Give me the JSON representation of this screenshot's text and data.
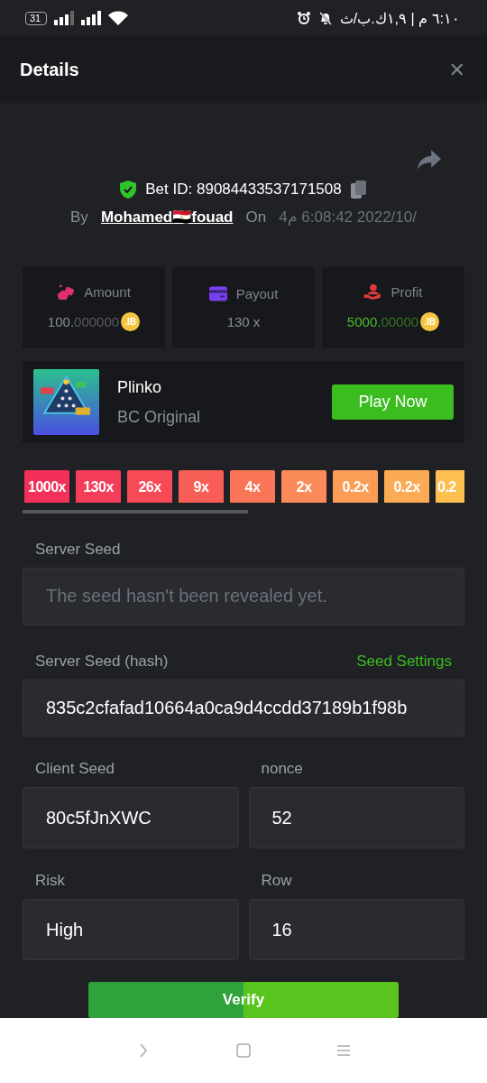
{
  "status_bar": {
    "battery": "31",
    "time": "٦:١٠ م | ١,٩ك.ب/ث"
  },
  "header": {
    "title": "Details",
    "close": "✕"
  },
  "bet": {
    "id_label": "Bet ID: 89084433537171508",
    "by": "By",
    "user": "Mohamed🇪🇬fouad",
    "on": "On",
    "date": "4م 6:08:42 2022/10/"
  },
  "stats": [
    {
      "kind": "amount",
      "label": "Amount",
      "value_main": "100.",
      "value_dim": "000000",
      "coin": ".IB"
    },
    {
      "kind": "payout",
      "label": "Payout",
      "value_main": "130 x"
    },
    {
      "kind": "profit",
      "label": "Profit",
      "value_main": "5000.",
      "value_dim": "00000",
      "coin": ".IB"
    }
  ],
  "game": {
    "kind": "picture",
    "name": "Plinko",
    "provider": "BC Original",
    "button": "Play Now"
  },
  "multipliers": [
    {
      "label": "1000x",
      "color": "#f2305a"
    },
    {
      "label": "130x",
      "color": "#f43d58"
    },
    {
      "label": "26x",
      "color": "#f64b57"
    },
    {
      "label": "9x",
      "color": "#f75f56"
    },
    {
      "label": "4x",
      "color": "#f87558"
    },
    {
      "label": "2x",
      "color": "#fa8a58"
    },
    {
      "label": "0.2x",
      "color": "#fb9d57"
    },
    {
      "label": "0.2x",
      "color": "#fcab55"
    },
    {
      "label": "0.2",
      "color": "#fdbf50"
    }
  ],
  "server_seed": {
    "label": "Server Seed",
    "placeholder": "The seed hasn't been revealed yet."
  },
  "server_hash": {
    "label": "Server Seed (hash)",
    "link": "Seed Settings",
    "value": "835c2cfafad10664a0ca9d4ccdd37189b1f98b"
  },
  "pairs": [
    [
      {
        "label": "Client Seed",
        "value": "80c5fJnXWC"
      },
      {
        "label": "nonce",
        "value": "52"
      }
    ],
    [
      {
        "label": "Risk",
        "value": "High"
      },
      {
        "label": "Row",
        "value": "16"
      }
    ]
  ],
  "verify": "Verify"
}
